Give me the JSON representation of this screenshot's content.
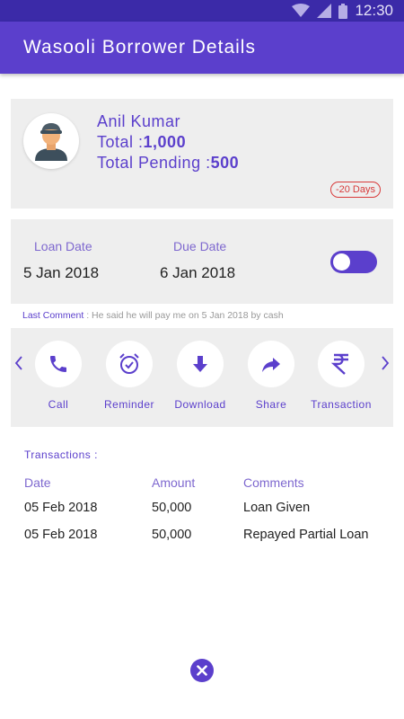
{
  "status_bar": {
    "time": "12:30"
  },
  "app_bar": {
    "title": "Wasooli Borrower Details"
  },
  "borrower": {
    "name": "Anil Kumar",
    "total_label": "Total :",
    "total_value": "1,000",
    "pending_label": "Total Pending :",
    "pending_value": "500",
    "days_badge": "-20 Days"
  },
  "dates": {
    "loan_date_label": "Loan Date",
    "loan_date_value": "5 Jan 2018",
    "due_date_label": "Due Date",
    "due_date_value": "6 Jan 2018",
    "toggle_on": true
  },
  "last_comment": {
    "label": "Last Comment",
    "text": " : He said he will pay me on 5 Jan 2018 by cash"
  },
  "actions": [
    {
      "label": "Call",
      "icon": "phone-icon"
    },
    {
      "label": "Reminder",
      "icon": "alarm-icon"
    },
    {
      "label": "Download",
      "icon": "download-icon"
    },
    {
      "label": "Share",
      "icon": "share-icon"
    },
    {
      "label": "Transaction",
      "icon": "rupee-icon"
    }
  ],
  "transactions": {
    "title": "Transactions :",
    "headers": {
      "date": "Date",
      "amount": "Amount",
      "comments": "Comments"
    },
    "rows": [
      {
        "date": "05 Feb 2018",
        "amount": "50,000",
        "comment": "Loan Given"
      },
      {
        "date": "05 Feb 2018",
        "amount": "50,000",
        "comment": "Repayed Partial Loan"
      }
    ]
  },
  "colors": {
    "primary": "#5b3fcc",
    "status_bar": "#3b2aa8",
    "badge": "#d83a3a",
    "card": "#eeeeee"
  }
}
